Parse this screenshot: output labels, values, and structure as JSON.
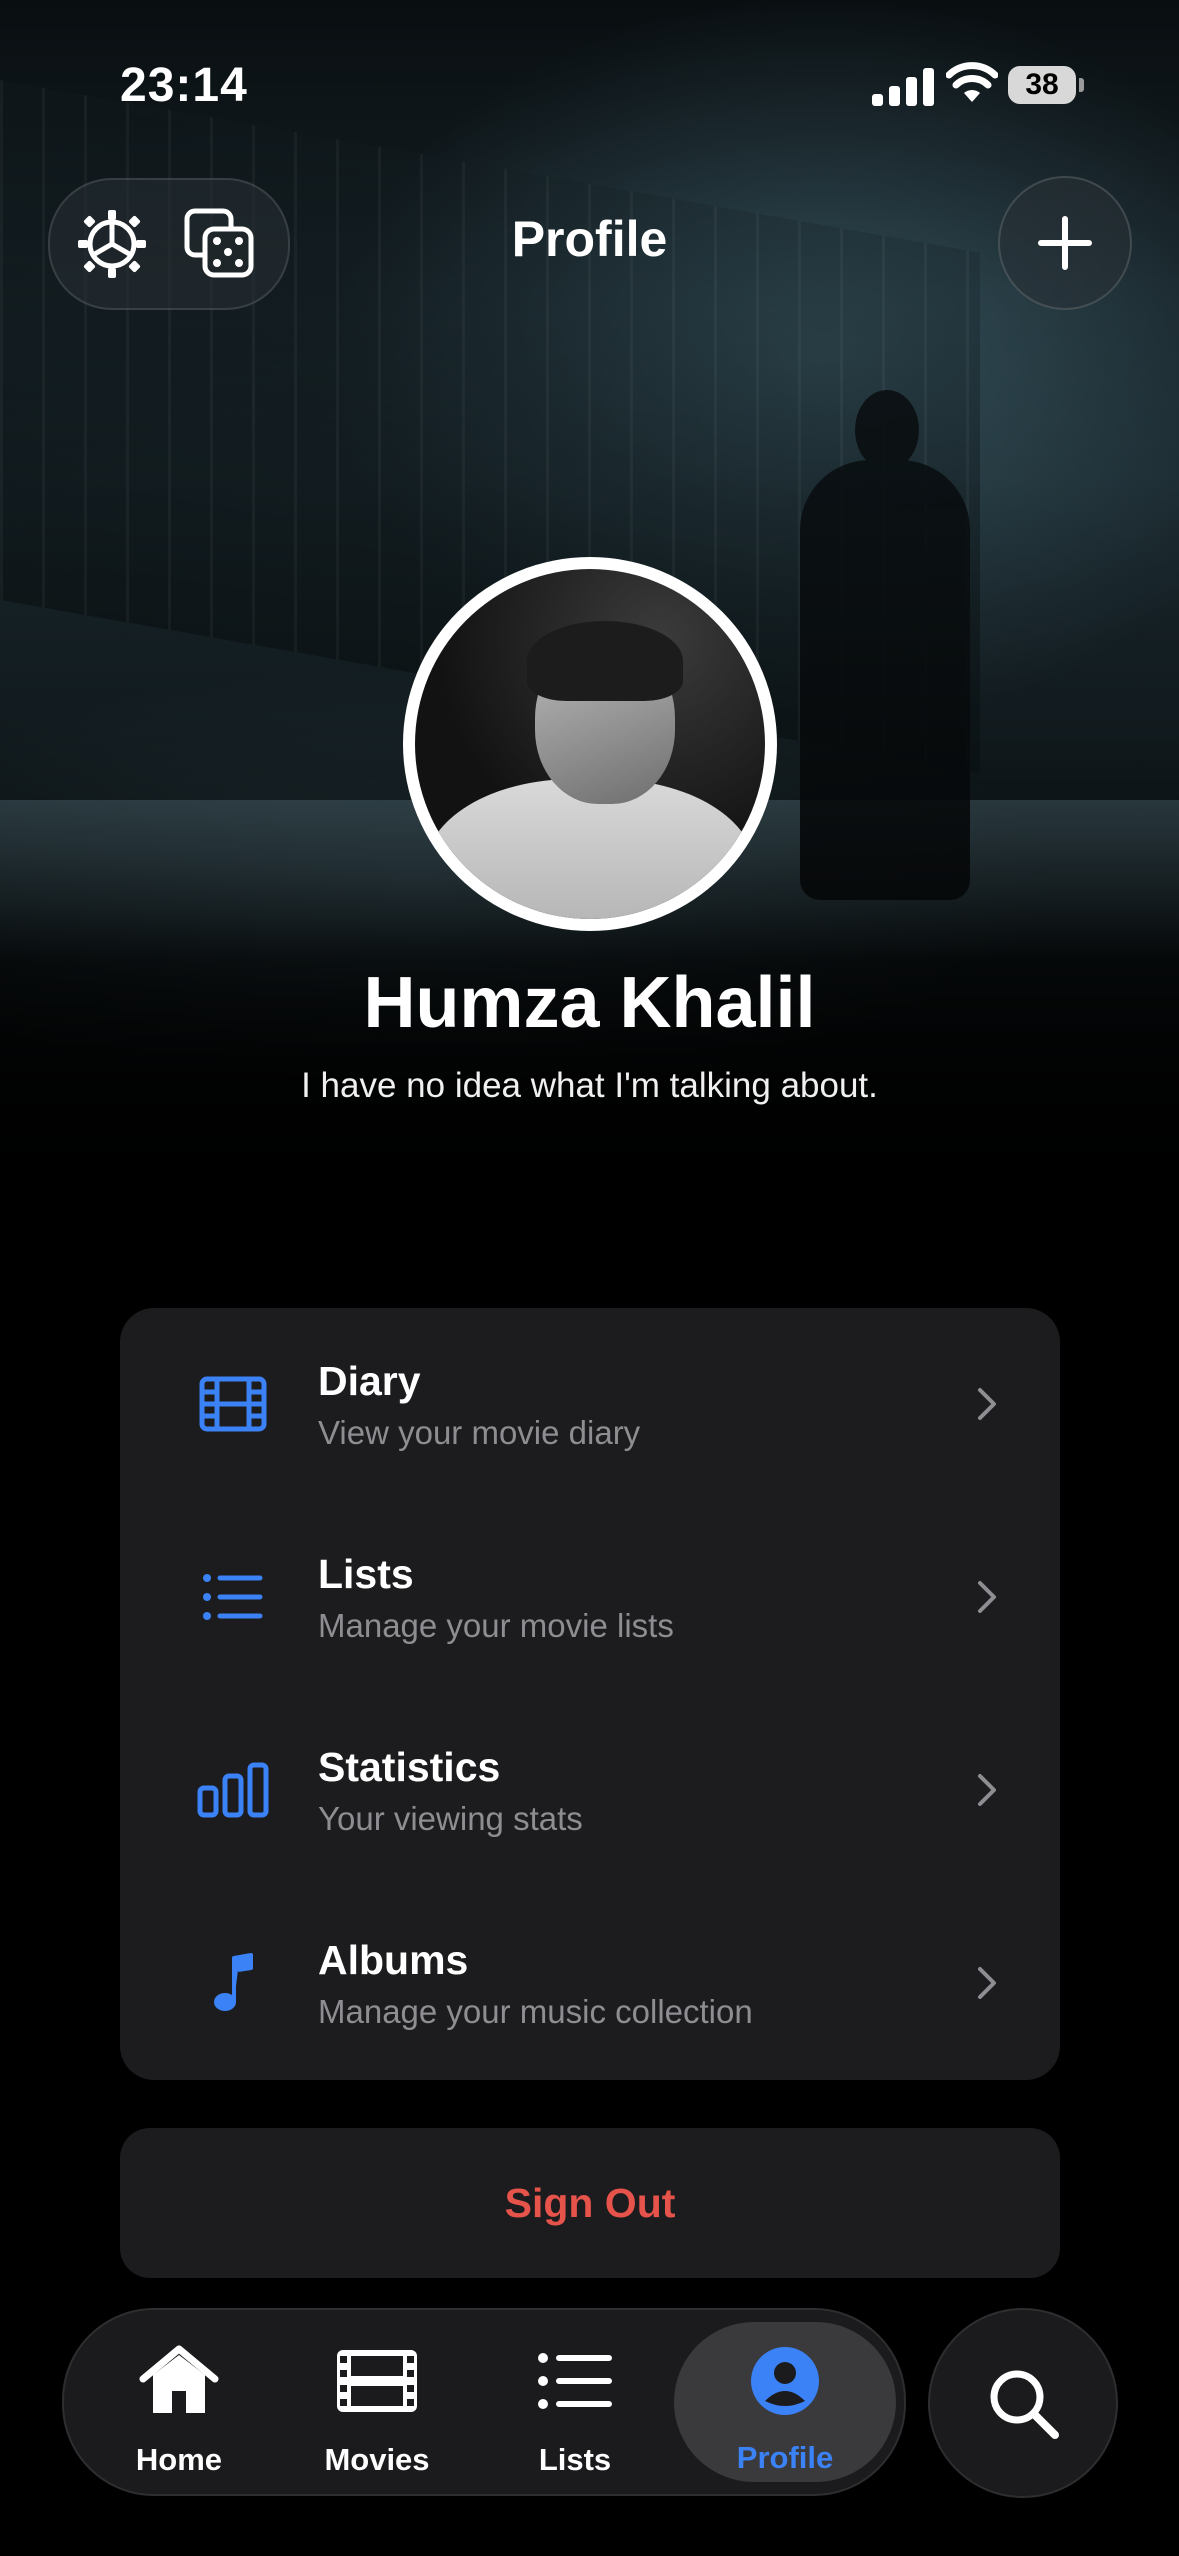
{
  "status_bar": {
    "time": "23:14",
    "battery": "38"
  },
  "header": {
    "title": "Profile"
  },
  "profile": {
    "name": "Humza Khalil",
    "bio": "I have no idea what I'm talking about."
  },
  "menu": {
    "items": [
      {
        "title": "Diary",
        "subtitle": "View your movie diary",
        "icon": "film-icon"
      },
      {
        "title": "Lists",
        "subtitle": "Manage your movie lists",
        "icon": "list-icon"
      },
      {
        "title": "Statistics",
        "subtitle": "Your viewing stats",
        "icon": "bar-chart-icon"
      },
      {
        "title": "Albums",
        "subtitle": "Manage your music collection",
        "icon": "music-note-icon"
      }
    ]
  },
  "sign_out": {
    "label": "Sign Out"
  },
  "tab_bar": {
    "tabs": [
      {
        "label": "Home",
        "icon": "home-icon"
      },
      {
        "label": "Movies",
        "icon": "film-strip-icon"
      },
      {
        "label": "Lists",
        "icon": "list-icon"
      },
      {
        "label": "Profile",
        "icon": "person-icon",
        "active": true
      }
    ]
  },
  "colors": {
    "accent": "#3b82f6",
    "danger": "#e5534b",
    "card": "#1c1c1e"
  }
}
